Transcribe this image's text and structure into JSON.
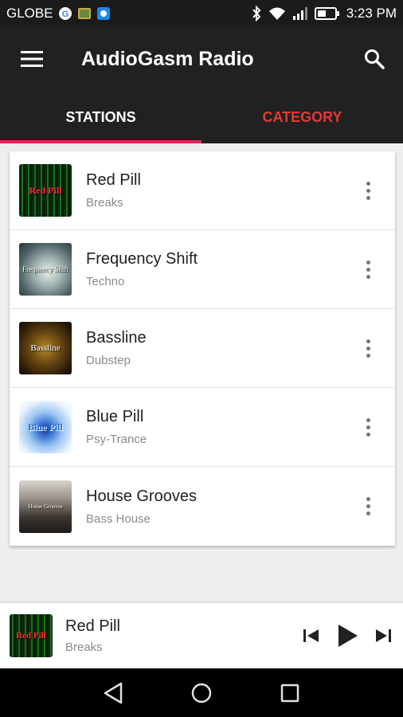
{
  "status_bar": {
    "carrier": "GLOBE",
    "time": "3:23 PM",
    "icons": [
      "google-icon",
      "photo-icon",
      "app-icon",
      "bluetooth-icon",
      "wifi-icon",
      "signal-icon",
      "battery-icon"
    ]
  },
  "app_bar": {
    "title": "AudioGasm Radio",
    "menu_icon": "hamburger-menu-icon",
    "search_icon": "search-icon"
  },
  "tabs": [
    {
      "label": "STATIONS",
      "selected": true
    },
    {
      "label": "CATEGORY",
      "selected": false
    }
  ],
  "colors": {
    "accent": "#e8245b",
    "category_tab": "#e53935",
    "app_bar": "#212121"
  },
  "stations": [
    {
      "name": "Red Pill",
      "genre": "Breaks",
      "art_text": "Red Pill"
    },
    {
      "name": "Frequency Shift",
      "genre": "Techno",
      "art_text": "Frequency Shift"
    },
    {
      "name": "Bassline",
      "genre": "Dubstep",
      "art_text": "Bassline"
    },
    {
      "name": "Blue Pill",
      "genre": "Psy-Trance",
      "art_text": "Blue Pill"
    },
    {
      "name": "House Grooves",
      "genre": "Bass House",
      "art_text": "House Grooves"
    }
  ],
  "player": {
    "name": "Red Pill",
    "genre": "Breaks",
    "art_text": "Red Pill",
    "controls": [
      "skip-previous-icon",
      "play-icon",
      "skip-next-icon"
    ]
  },
  "nav_bar": {
    "buttons": [
      "back-icon",
      "home-icon",
      "recents-icon"
    ]
  }
}
